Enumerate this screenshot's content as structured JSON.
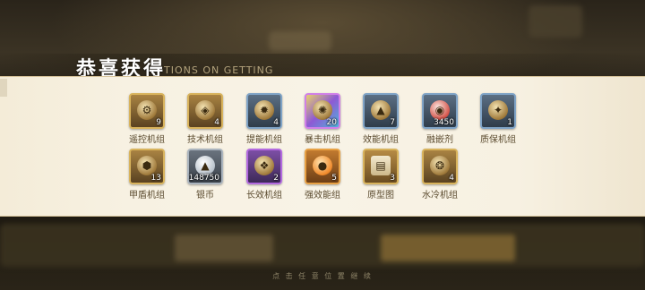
{
  "header": {
    "title": "恭喜获得",
    "subtitle": "TIONS ON GETTING"
  },
  "rewards_row1": [
    {
      "label": "遥控机组",
      "count": "9",
      "style": "gold",
      "icon": "gear-chip-icon"
    },
    {
      "label": "技术机组",
      "count": "4",
      "style": "gold",
      "icon": "chip-icon"
    },
    {
      "label": "提能机组",
      "count": "4",
      "style": "blue",
      "icon": "sun-gear-icon"
    },
    {
      "label": "暴击机组",
      "count": "20",
      "style": "rainbow",
      "icon": "burst-icon"
    },
    {
      "label": "效能机组",
      "count": "7",
      "style": "blue",
      "icon": "triangle-core-icon"
    },
    {
      "label": "融嵌剂",
      "count": "3450",
      "style": "blue",
      "icon": "capsule-icon"
    },
    {
      "label": "质保机组",
      "count": "1",
      "style": "blue",
      "icon": "shield-chip-icon"
    }
  ],
  "rewards_row2": [
    {
      "label": "甲盾机组",
      "count": "13",
      "style": "gold",
      "icon": "armor-chip-icon"
    },
    {
      "label": "银币",
      "count": "148750",
      "style": "silver",
      "icon": "silver-coin-icon"
    },
    {
      "label": "长效机组",
      "count": "2",
      "style": "purple",
      "icon": "long-chip-icon"
    },
    {
      "label": "强效能组",
      "count": "5",
      "style": "orange",
      "icon": "orb-icon"
    },
    {
      "label": "原型图",
      "count": "3",
      "style": "paper",
      "icon": "blueprint-icon"
    },
    {
      "label": "水冷机组",
      "count": "4",
      "style": "gold",
      "icon": "cooling-chip-icon"
    }
  ],
  "footer_text": "点 击 任 意 位 置 继 续"
}
